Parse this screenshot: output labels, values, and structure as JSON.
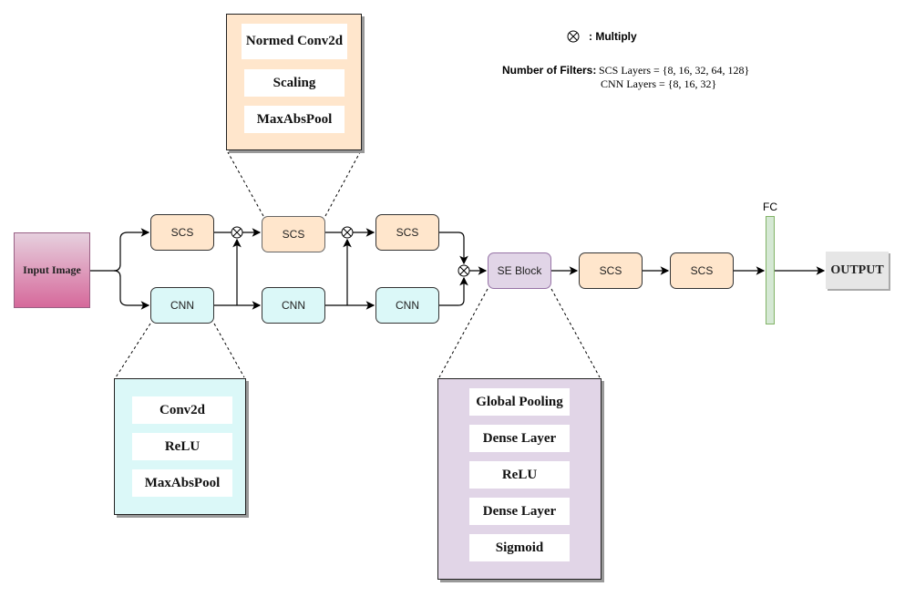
{
  "input": {
    "label": "Input Image"
  },
  "scs_blocks": [
    "SCS",
    "SCS",
    "SCS",
    "SCS",
    "SCS"
  ],
  "cnn_blocks": [
    "CNN",
    "CNN",
    "CNN"
  ],
  "se_block": {
    "label": "SE Block"
  },
  "fc": {
    "label": "FC"
  },
  "output": {
    "label": "OUTPUT"
  },
  "scs_detail": [
    "Normed Conv2d",
    "Scaling",
    "MaxAbsPool"
  ],
  "cnn_detail": [
    "Conv2d",
    "ReLU",
    "MaxAbsPool"
  ],
  "se_detail": [
    "Global Pooling",
    "Dense Layer",
    "ReLU",
    "Dense Layer",
    "Sigmoid"
  ],
  "legend": {
    "multiply_symbol": "⊗",
    "multiply_label": ": Multiply",
    "filters_title": "Number of Filters:",
    "scs_filters": "SCS Layers = {8, 16, 32, 64, 128}",
    "cnn_filters": "CNN Layers = {8, 16, 32}"
  },
  "colors": {
    "scs": "#ffe6cc",
    "cnn": "#dbf8f8",
    "se": "#e1d5e7",
    "fc": "#d5e8d4",
    "output": "#e6e6e6"
  }
}
